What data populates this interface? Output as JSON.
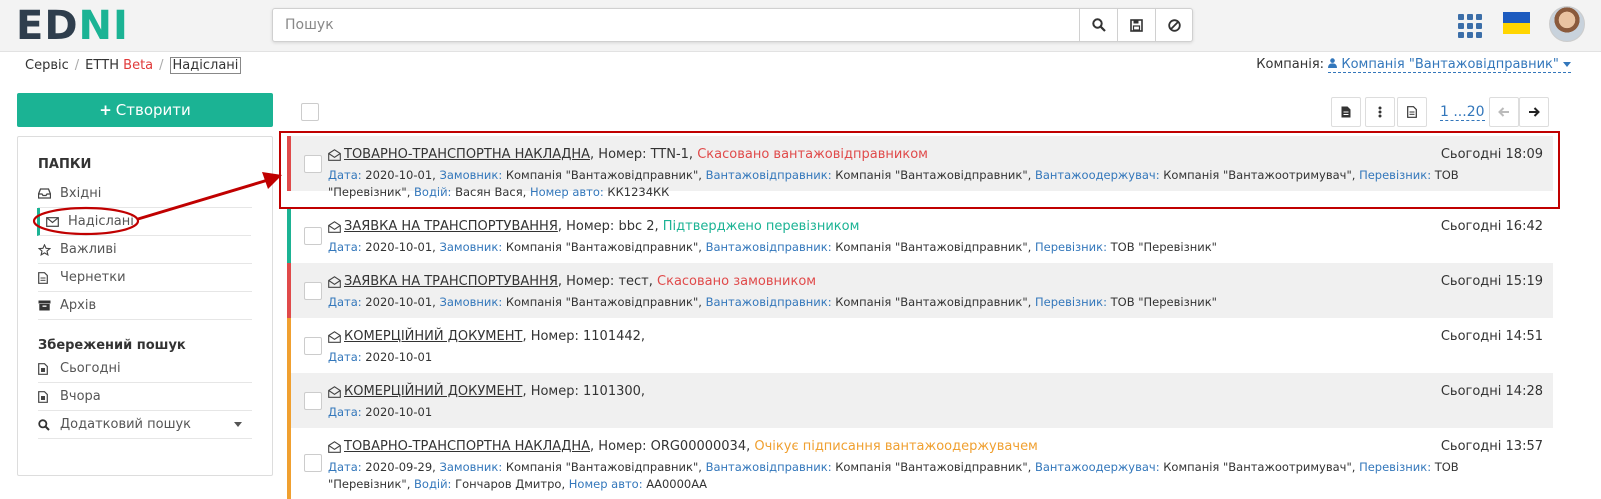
{
  "header": {
    "logo_a": "ED",
    "logo_b": "N",
    "logo_c": "I",
    "search_placeholder": "Пошук",
    "icons": [
      "search-icon",
      "save-icon",
      "clear-icon",
      "apps-grid-icon",
      "ukraine-flag-icon",
      "user-avatar"
    ]
  },
  "breadcrumb": {
    "items": [
      "Сервіс",
      "ЕТТН",
      "Надіслані"
    ],
    "beta": "Beta"
  },
  "company": {
    "label": "Компанія:",
    "value": "Компанія \"Вантажовідправник\""
  },
  "sidebar": {
    "create_label": "Створити",
    "folders_title": "ПАПКИ",
    "folders": [
      {
        "label": "Вхідні",
        "icon": "inbox-icon"
      },
      {
        "label": "Надіслані",
        "icon": "envelope-icon",
        "active": true
      },
      {
        "label": "Важливі",
        "icon": "star-icon"
      },
      {
        "label": "Чернетки",
        "icon": "draft-icon"
      },
      {
        "label": "Архів",
        "icon": "archive-icon"
      }
    ],
    "saved_title": "Збережений пошук",
    "saved": [
      {
        "label": "Сьогодні",
        "icon": "calendar-icon"
      },
      {
        "label": "Вчора",
        "icon": "calendar-icon"
      },
      {
        "label": "Додатковий пошук",
        "icon": "search-icon"
      }
    ]
  },
  "toolbar": {
    "pages": "1 ...20",
    "icons": [
      "export-icon",
      "more-icon",
      "document-icon",
      "prev-icon",
      "next-icon"
    ]
  },
  "documents": [
    {
      "title": "ТОВАРНО-ТРАНСПОРТНА НАКЛАДНА",
      "number": ", Номер: TTN-1,",
      "status": "Скасовано вантажовідправником",
      "status_color": "#e04a4a",
      "time": "Сьогодні 18:09",
      "border_color": "#e04a4a",
      "details": [
        [
          "Дата:",
          " 2020-10-01,"
        ],
        [
          "Замовник:",
          " Компанія \"Вантажовідправник\","
        ],
        [
          "Вантажовідправник:",
          " Компанія \"Вантажовідправник\","
        ],
        [
          "Вантажоодержувач:",
          " Компанія \"Вантажоотримувач\","
        ],
        [
          "Перевізник:",
          " ТОВ \"Перевізник\","
        ],
        [
          "Водій:",
          " Васян Вася,"
        ],
        [
          "Номер авто:",
          " КК1234КК"
        ]
      ]
    },
    {
      "title": "ЗАЯВКА НА ТРАНСПОРТУВАННЯ",
      "number": ", Номер: bbc 2,",
      "status": "Підтверджено перевізником",
      "status_color": "#1bb394",
      "time": "Сьогодні 16:42",
      "border_color": "#1bb394",
      "details": [
        [
          "Дата:",
          " 2020-10-01,"
        ],
        [
          "Замовник:",
          " Компанія \"Вантажовідправник\","
        ],
        [
          "Вантажовідправник:",
          " Компанія \"Вантажовідправник\","
        ],
        [
          "Перевізник:",
          " ТОВ \"Перевізник\""
        ]
      ]
    },
    {
      "title": "ЗАЯВКА НА ТРАНСПОРТУВАННЯ",
      "number": ", Номер: тест,",
      "status": "Скасовано замовником",
      "status_color": "#e04a4a",
      "time": "Сьогодні 15:19",
      "border_color": "#e04a4a",
      "details": [
        [
          "Дата:",
          " 2020-10-01,"
        ],
        [
          "Замовник:",
          " Компанія \"Вантажовідправник\","
        ],
        [
          "Вантажовідправник:",
          " Компанія \"Вантажовідправник\","
        ],
        [
          "Перевізник:",
          " ТОВ \"Перевізник\""
        ]
      ]
    },
    {
      "title": "КОМЕРЦІЙНИЙ ДОКУМЕНТ",
      "number": ", Номер: 1101442,",
      "status": "",
      "status_color": "#333333",
      "time": "Сьогодні 14:51",
      "border_color": "#f0a030",
      "details": [
        [
          "Дата:",
          " 2020-10-01"
        ]
      ]
    },
    {
      "title": "КОМЕРЦІЙНИЙ ДОКУМЕНТ",
      "number": ", Номер: 1101300,",
      "status": "",
      "status_color": "#333333",
      "time": "Сьогодні 14:28",
      "border_color": "#f0a030",
      "details": [
        [
          "Дата:",
          " 2020-10-01"
        ]
      ]
    },
    {
      "title": "ТОВАРНО-ТРАНСПОРТНА НАКЛАДНА",
      "number": ", Номер: ORG00000034,",
      "status": "Очікує підписання вантажоодержувачем",
      "status_color": "#f0a030",
      "time": "Сьогодні 13:57",
      "border_color": "#f0a030",
      "details": [
        [
          "Дата:",
          " 2020-09-29,"
        ],
        [
          "Замовник:",
          " Компанія \"Вантажовідправник\","
        ],
        [
          "Вантажовідправник:",
          " Компанія \"Вантажовідправник\","
        ],
        [
          "Вантажоодержувач:",
          " Компанія \"Вантажоотримувач\","
        ],
        [
          "Перевізник:",
          " ТОВ \"Перевізник\","
        ],
        [
          "Водій:",
          " Гончаров Дмитро,"
        ],
        [
          "Номер авто:",
          " АА0000АА"
        ]
      ]
    }
  ],
  "colors": {
    "accent": "#1bb394",
    "link": "#3377bb",
    "annotation": "#c00000"
  }
}
